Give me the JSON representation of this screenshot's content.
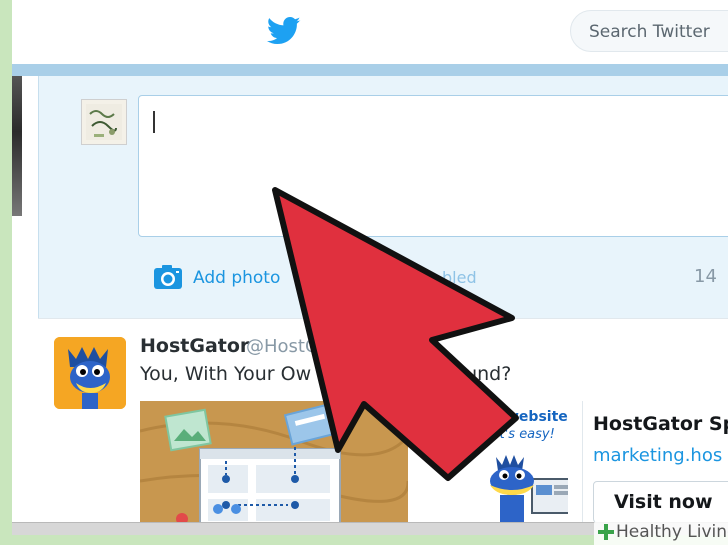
{
  "header": {
    "search_placeholder": "Search Twitter",
    "bird_color": "#1da1f2"
  },
  "compose": {
    "add_photo_label": "Add photo",
    "location_label": "bled",
    "char_count": "14",
    "icons": {
      "photo": "camera-icon"
    }
  },
  "tweet": {
    "name": "HostGator",
    "handle": "@HostG",
    "text": "You, With Your Ow                         w Does That Sound?",
    "card": {
      "banner_word": "website",
      "banner_tagline": "it's easy!",
      "title": "HostGator Sp",
      "url": "marketing.hos",
      "button_label": "Visit now"
    }
  },
  "colors": {
    "accent": "#1b95e0",
    "arrow": "#e0303e",
    "compose_bg": "#e8f4fb"
  },
  "watermark": {
    "text": "Healthy Living"
  }
}
